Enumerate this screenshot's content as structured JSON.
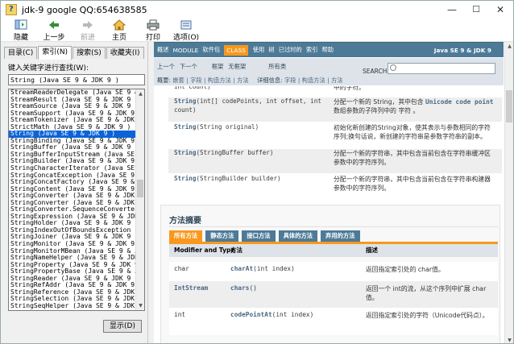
{
  "window": {
    "title": "jdk-9 google QQ:654638585",
    "controls": [
      "—",
      "☐",
      "✕"
    ]
  },
  "toolbar": {
    "hide": "隐藏",
    "back": "上一步",
    "forward": "前进",
    "home": "主页",
    "print": "打印",
    "options": "选项(O)"
  },
  "left": {
    "tabs": [
      "目录(C)",
      "索引(N)",
      "搜索(S)",
      "收藏夹(I)"
    ],
    "active_tab": 1,
    "keyword_label": "键入关键字进行查找(W):",
    "keyword_value": "String (Java SE 9 & JDK 9 )",
    "items": [
      "StreamReaderDelegate (Java SE 9 &",
      "StreamResult (Java SE 9 & JDK 9 )",
      "StreamSource (Java SE 9 & JDK 9 )",
      "StreamSupport (Java SE 9 & JDK 9 )",
      "StreamTokenizer (Java SE 9 & JDK 9",
      "StrictMath (Java SE 9 & JDK 9 )",
      "String (Java SE 9 & JDK 9 )",
      "StringBinding (Java SE 9 & JDK 9 )",
      "StringBuffer (Java SE 9 & JDK 9 )",
      "StringBufferInputStream (Java SE 9",
      "StringBuilder (Java SE 9 & JDK 9 )",
      "StringCharacterIterator (Java SE 9",
      "StringConcatException (Java SE 9 &",
      "StringConcatFactory (Java SE 9 & J",
      "StringContent (Java SE 9 & JDK 9 )",
      "StringConverter (Java SE 9 & JDK 9",
      "StringConverter (Java SE 9 & JDK 9",
      "StringConverter.SequenceConverter",
      "StringExpression (Java SE 9 & JDK",
      "StringHolder (Java SE 9 & JDK 9 )",
      "StringIndexOutOfBoundsException (J",
      "StringJoiner (Java SE 9 & JDK 9 )",
      "StringMonitor (Java SE 9 & JDK 9 )",
      "StringMonitorMBean (Java SE 9 & JD",
      "StringNameHelper (Java SE 9 & JDK",
      "StringProperty (Java SE 9 & JDK 9",
      "StringPropertyBase (Java SE 9 & JD",
      "StringReader (Java SE 9 & JDK 9 )",
      "StringRefAddr (Java SE 9 & JDK 9 )",
      "StringReference (Java SE 9 & JDK 9",
      "StringSelection (Java SE 9 & JDK 9",
      "StringSeqHelper (Java SE 9 & JDK 9",
      "StringSeqHolder (Java SE 9 & JDK 9"
    ],
    "selected_index": 6,
    "display_button": "显示(D)"
  },
  "doc": {
    "nav": [
      "概述",
      "MODULE",
      "软件包",
      "CLASS",
      "使用",
      "树",
      "已过时的",
      "索引",
      "帮助"
    ],
    "nav_active": 3,
    "version": "Java SE 9 & JDK 9",
    "subnav_row1": [
      "上一个",
      "下一个",
      "框架",
      "无框架",
      "所有类"
    ],
    "subnav_row2_label1": "概要:",
    "subnav_row2_text1": "嵌套 | 字段 | 构造方法 | 方法",
    "subnav_row2_label2": "详细信息:",
    "subnav_row2_text2": "字段 | 构造方法 | 方法",
    "search_label": "SEARCH:",
    "constructors": [
      {
        "sig_kw": "",
        "sig": "int count)",
        "desc": "中的字符。"
      },
      {
        "sig_kw": "String",
        "sig": "(int[] codePoints, int offset, int count)",
        "desc_pre": "分配一个新的 String，其中包含 ",
        "desc_code": "Unicode code point",
        "desc_post": "数组参数的子阵列中的 字符 。"
      },
      {
        "sig_kw": "String",
        "sig": "(String original)",
        "desc": "初始化新创建的String对象，使其表示与参数相同的字符序列;换句话说，新创建的字符串是参数字符串的副本。"
      },
      {
        "sig_kw": "String",
        "sig": "(StringBuffer buffer)",
        "desc": "分配一个新的字符串，其中包含当前包含在字符串缓冲区参数中的字符序列。"
      },
      {
        "sig_kw": "String",
        "sig": "(StringBuilder builder)",
        "desc": "分配一个新的字符串，其中包含当前包含在字符串构建器参数中的字符序列。"
      }
    ],
    "method_summary_title": "方法摘要",
    "method_tabs": [
      "所有方法",
      "静态方法",
      "接口方法",
      "具体的方法",
      "弃用的方法"
    ],
    "method_tab_active": 0,
    "method_headers": [
      "Modifier and Type",
      "方法",
      "描述"
    ],
    "methods": [
      {
        "mod": "char",
        "mod_link": false,
        "name": "charAt",
        "params": "(int index)",
        "desc": "返回指定索引处的 char值。"
      },
      {
        "mod": "IntStream",
        "mod_link": true,
        "name": "chars",
        "params": "()",
        "desc": "返回一个 int的流，从这个序列中扩展 char值。"
      },
      {
        "mod": "int",
        "mod_link": false,
        "name": "codePointAt",
        "params": "(int index)",
        "desc": "返回指定索引处的字符（Unicode代码点）。"
      }
    ]
  }
}
